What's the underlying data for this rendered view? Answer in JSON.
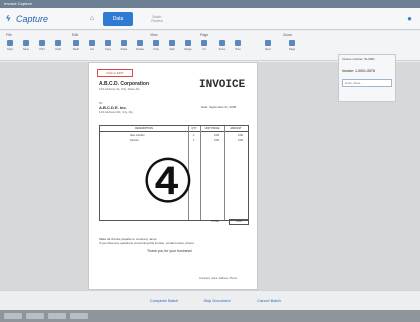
{
  "window": {
    "title": "Invoice Capture"
  },
  "header": {
    "logo_text": "Capture",
    "tab_primary": "Data",
    "tab_secondary_line1": "Batch",
    "tab_secondary_line2": "Review"
  },
  "toolbar": {
    "groups": [
      "File",
      "Edit",
      "View",
      "Page",
      "Zoom"
    ],
    "tools": [
      "Open",
      "Save",
      "Print",
      "Undo",
      "Redo",
      "Cut",
      "Copy",
      "Paste",
      "Rotate",
      "Crop",
      "Split",
      "Merge",
      "Fit",
      "Zoom",
      "Prev",
      "Next",
      "Page"
    ]
  },
  "document": {
    "edit_tag": "Click to EDIT",
    "company": "A.B.C.D. Corporation",
    "company_sub": "123 Address St, City, State Zip",
    "title": "INVOICE",
    "to_label": "To:",
    "client": "A.B.C.D.E. Inc.",
    "client_sub": "123 Address Rd, City, Zip",
    "date": "Date: September 21, 2005",
    "table_headers": [
      "DESCRIPTION",
      "QTY",
      "UNIT PRICE",
      "AMOUNT"
    ],
    "rows": [
      {
        "desc": "Item number",
        "qty": "1",
        "price": "0.00",
        "amount": "0.00"
      },
      {
        "desc": "Service",
        "qty": "1",
        "price": "0.00",
        "amount": "0.00"
      }
    ],
    "total_label": "TOTAL",
    "total_value": "0.00",
    "circled_number": "④",
    "note": "Make all checks payable to company name.",
    "note2": "If you have any questions concerning this invoice, contact name, phone.",
    "thanks": "Thank you for your business!",
    "footer_note": "Company name, Address, Phone"
  },
  "side_panel": {
    "title": "Invoice number: IN-0001",
    "value": "Invoice: 1-0001-0576",
    "input_placeholder": "Enter value..."
  },
  "bottombar": {
    "buttons": [
      "Complete Batch",
      "Skip Document",
      "Cancel Batch"
    ]
  }
}
